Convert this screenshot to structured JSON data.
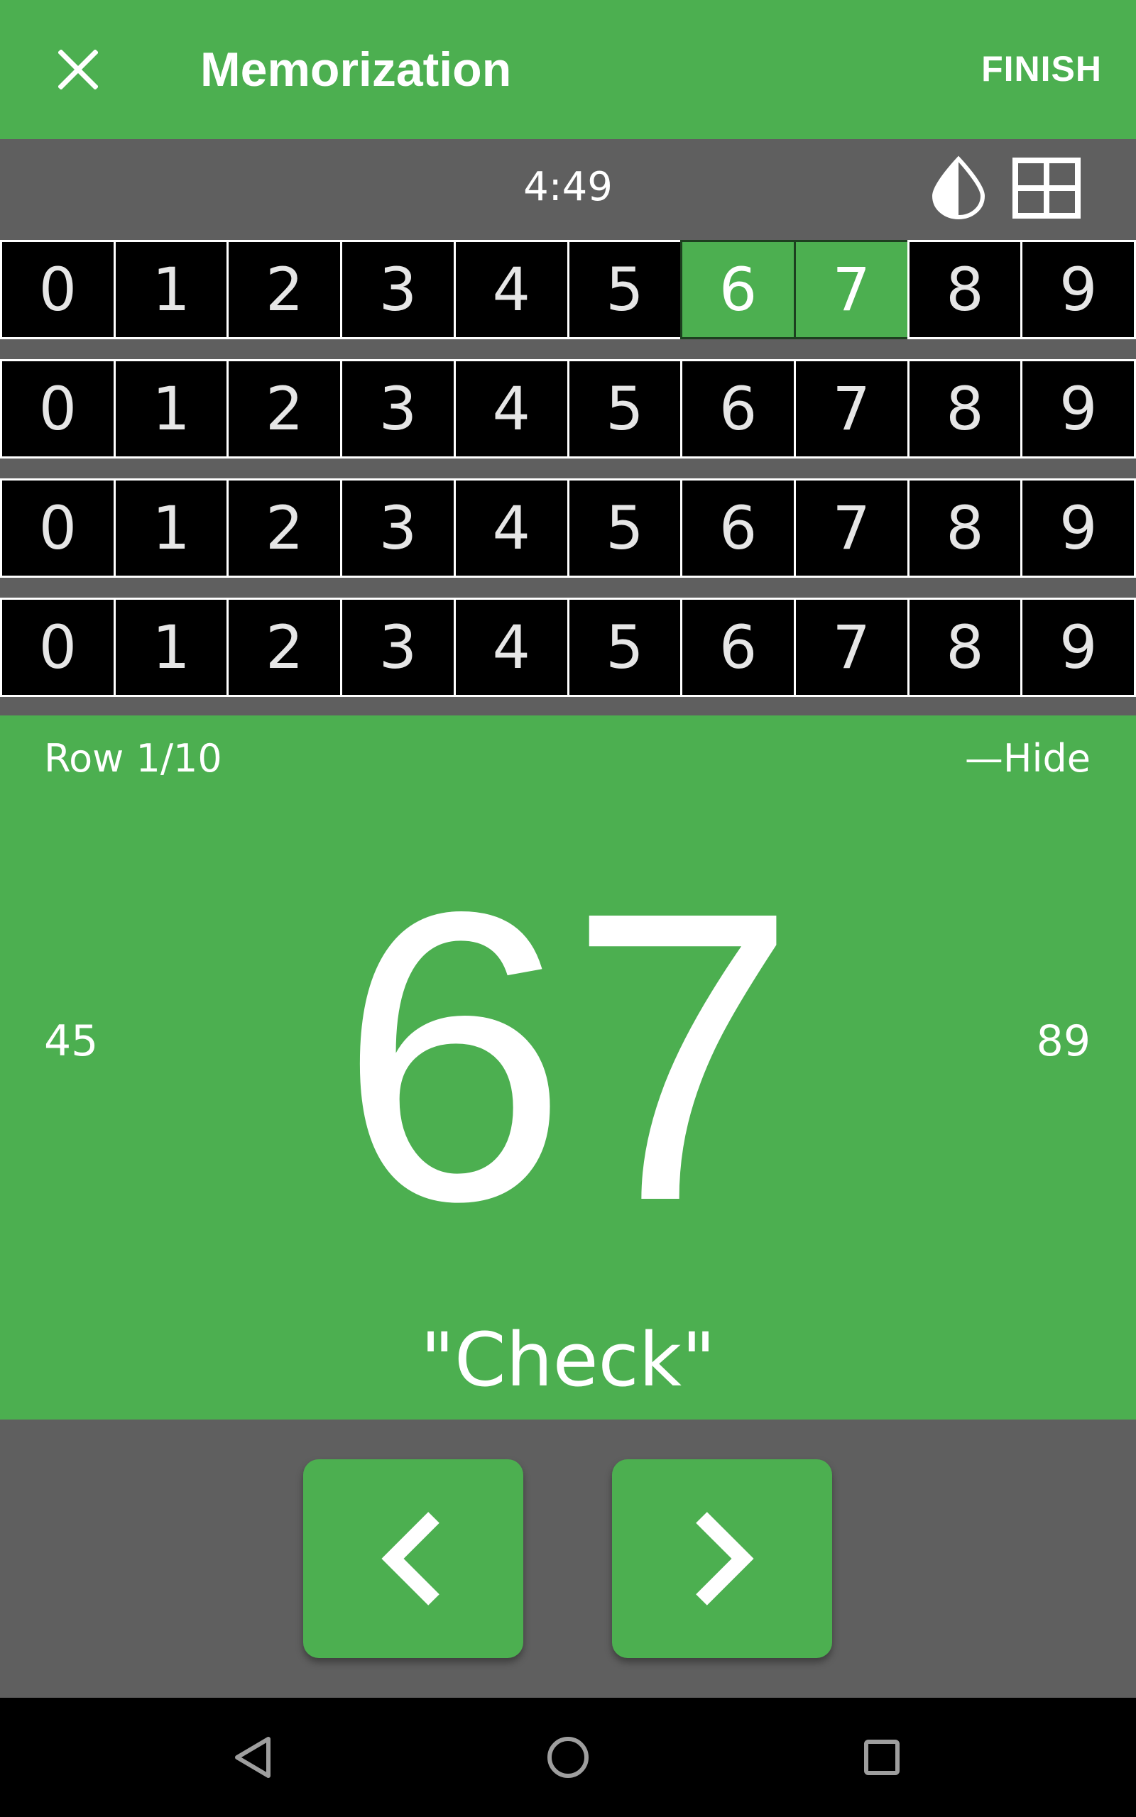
{
  "app_bar": {
    "title": "Memorization",
    "finish_label": "FINISH",
    "close_icon": "close-icon",
    "background": "#4caf50"
  },
  "timer_bar": {
    "time": "4:49",
    "contrast_icon": "contrast-icon",
    "grid_icon": "grid-icon"
  },
  "digit_rows": [
    {
      "digits": [
        "0",
        "1",
        "2",
        "3",
        "4",
        "5",
        "6",
        "7",
        "8",
        "9"
      ],
      "highlighted": [
        6,
        7
      ]
    },
    {
      "digits": [
        "0",
        "1",
        "2",
        "3",
        "4",
        "5",
        "6",
        "7",
        "8",
        "9"
      ],
      "highlighted": []
    },
    {
      "digits": [
        "0",
        "1",
        "2",
        "3",
        "4",
        "5",
        "6",
        "7",
        "8",
        "9"
      ],
      "highlighted": []
    },
    {
      "digits": [
        "0",
        "1",
        "2",
        "3",
        "4",
        "5",
        "6",
        "7",
        "8",
        "9"
      ],
      "highlighted": []
    }
  ],
  "main": {
    "row_label": "Row 1/10",
    "hide_label": "—Hide",
    "previous_pair": "45",
    "current_pair": "67",
    "next_pair": "89",
    "word": "\"Check\""
  },
  "controls": {
    "prev_icon": "chevron-left-icon",
    "next_icon": "chevron-right-icon"
  },
  "system_nav": {
    "back_icon": "back-triangle-icon",
    "home_icon": "home-circle-icon",
    "recent_icon": "recents-square-icon"
  },
  "colors": {
    "accent": "#4caf50",
    "panel_gray": "#5f5f5f",
    "cell_black": "#000000",
    "text_white": "#ffffff"
  }
}
